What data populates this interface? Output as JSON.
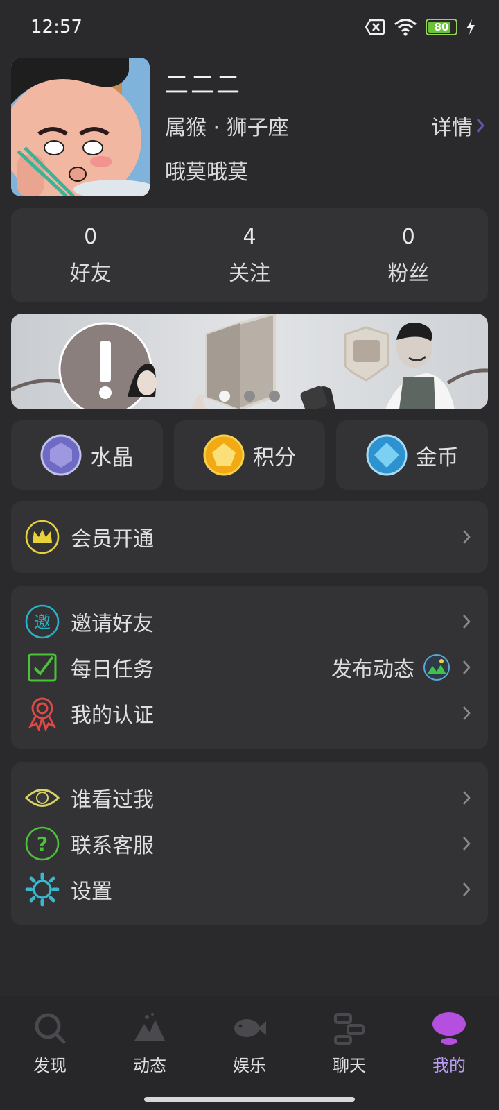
{
  "status_bar": {
    "time": "12:57",
    "battery": "80"
  },
  "profile": {
    "nickname": "二二二",
    "zodiac": "属猴 · 狮子座",
    "details_label": "详情",
    "bio": "哦莫哦莫"
  },
  "stats": [
    {
      "value": "0",
      "label": "好友"
    },
    {
      "value": "4",
      "label": "关注"
    },
    {
      "value": "0",
      "label": "粉丝"
    }
  ],
  "banner": {
    "slides": 3,
    "active_slide": 1
  },
  "currencies": [
    {
      "label": "水晶",
      "icon": "crystal-icon",
      "color": "#8b86d8"
    },
    {
      "label": "积分",
      "icon": "points-icon",
      "color": "#f0b21c"
    },
    {
      "label": "金币",
      "icon": "coin-icon",
      "color": "#3aa7e0"
    }
  ],
  "vip": {
    "label": "会员开通",
    "icon": "crown-icon",
    "color": "#e8d23a"
  },
  "menu_group_1": [
    {
      "label": "邀请好友",
      "icon": "invite-icon",
      "color": "#2ab3c8",
      "icon_text": "邀"
    },
    {
      "label": "每日任务",
      "icon": "checkbox-icon",
      "color": "#4cc23a",
      "extra": "发布动态"
    },
    {
      "label": "我的认证",
      "icon": "badge-icon",
      "color": "#e04848"
    }
  ],
  "menu_group_2": [
    {
      "label": "谁看过我",
      "icon": "eye-icon",
      "color": "#d8d26a"
    },
    {
      "label": "联系客服",
      "icon": "help-icon",
      "color": "#4cc23a",
      "icon_text": "?"
    },
    {
      "label": "设置",
      "icon": "gear-icon",
      "color": "#3ab8d0"
    }
  ],
  "tabs": [
    {
      "label": "发现",
      "icon": "search-icon"
    },
    {
      "label": "动态",
      "icon": "mountain-icon"
    },
    {
      "label": "娱乐",
      "icon": "fish-icon"
    },
    {
      "label": "聊天",
      "icon": "chat-icon"
    },
    {
      "label": "我的",
      "icon": "user-bubble-icon",
      "active": true
    }
  ]
}
